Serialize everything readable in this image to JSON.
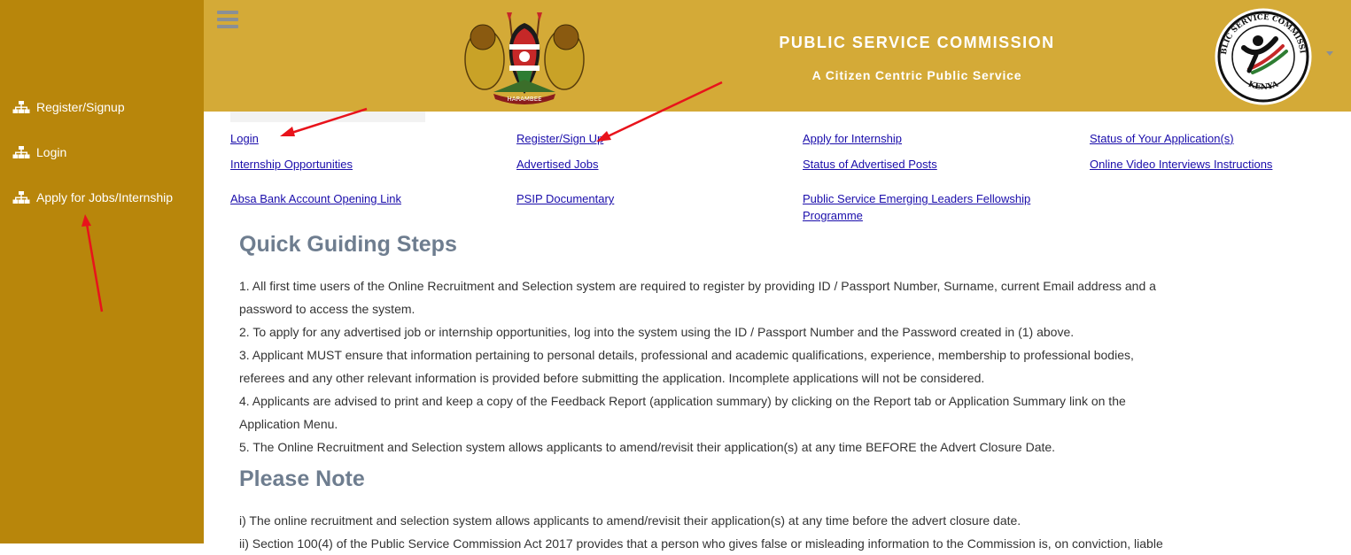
{
  "sidebar": {
    "items": [
      {
        "label": "Register/Signup",
        "icon": "sitemap-icon"
      },
      {
        "label": "Login",
        "icon": "sitemap-icon"
      },
      {
        "label": "Apply for Jobs/Internship",
        "icon": "sitemap-icon"
      }
    ]
  },
  "header": {
    "title": "PUBLIC SERVICE COMMISSION",
    "subtitle": "A Citizen Centric Public Service",
    "coat_motto": "HARAMBEE",
    "seal_text": "PUBLIC SERVICE COMMISSION",
    "seal_country": "KENYA"
  },
  "links": [
    "Login",
    "Register/Sign Up",
    "Apply for Internship",
    "Status of Your Application(s)",
    "Internship Opportunities",
    "Advertised Jobs",
    "Status of Advertised Posts",
    "Online Video Interviews Instructions",
    "Absa Bank Account Opening Link",
    "PSIP Documentary",
    "Public Service Emerging Leaders Fellowship",
    "Programme"
  ],
  "steps": {
    "heading": "Quick Guiding Steps",
    "items": [
      "1. All first time users of the Online Recruitment and Selection system are required to register by providing ID / Passport Number, Surname, current Email address and a password to access the system.",
      "2. To apply for any advertised job or internship opportunities, log into the system using the ID / Passport Number and the Password created in (1) above.",
      "3. Applicant MUST ensure that information pertaining to personal details, professional and academic qualifications, experience, membership to professional bodies, referees and any other relevant information is provided before submitting the application. Incomplete applications will not be considered.",
      "4. Applicants are advised to print and keep a copy of the Feedback Report (application summary) by clicking on the Report tab or Application Summary link on the Application Menu.",
      "5. The Online Recruitment and Selection system allows applicants to amend/revisit their application(s) at any time BEFORE the Advert Closure Date."
    ]
  },
  "note": {
    "heading": "Please Note",
    "items": [
      "i) The online recruitment and selection system allows applicants to amend/revisit their application(s) at any time before the advert closure date.",
      "ii) Section 100(4) of the Public Service Commission Act 2017 provides that a person who gives false or misleading information to the Commission is, on conviction, liable"
    ]
  },
  "colors": {
    "sidebar": "#b8860b",
    "header": "#d4aa37",
    "link": "#1a0dab",
    "heading": "#6e7d8f",
    "annotation_arrow": "#e8131b"
  }
}
